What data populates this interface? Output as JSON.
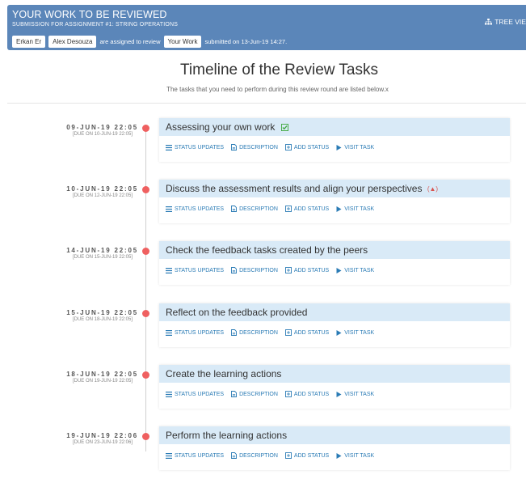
{
  "header": {
    "title": "YOUR WORK TO BE REVIEWED",
    "subtitle": "SUBMISSION FOR ASSIGNMENT #1: STRING OPERATIONS",
    "reviewer_1": "Erkan Er",
    "reviewer_2": "Alex Desouza",
    "assigned_text": "are assigned to review",
    "your_work": "Your Work",
    "submitted_text": "submitted on 13-Jun-19 14:27.",
    "tree_view": "TREE VIEW"
  },
  "page": {
    "title": "Timeline of the Review Tasks",
    "subtitle": "The tasks that you need to perform during this review round are listed below.x"
  },
  "actions": {
    "status_updates": "STATUS UPDATES",
    "description": "DESCRIPTION",
    "add_status": "ADD STATUS",
    "visit_task": "VISIT TASK"
  },
  "tasks": [
    {
      "date": "09-JUN-19 22:05",
      "due": "[DUE ON 10-JUN-19 22:05]",
      "title": "Assessing your own work",
      "status": "done"
    },
    {
      "date": "10-JUN-19 22:05",
      "due": "[DUE ON 12-JUN-19 22:05]",
      "title": "Discuss the assessment results and align your perspectives",
      "status": "alert"
    },
    {
      "date": "14-JUN-19 22:05",
      "due": "[DUE ON 15-JUN-19 22:05]",
      "title": "Check the feedback tasks created by the peers",
      "status": ""
    },
    {
      "date": "15-JUN-19 22:05",
      "due": "[DUE ON 18-JUN-19 22:05]",
      "title": "Reflect on the feedback provided",
      "status": ""
    },
    {
      "date": "18-JUN-19 22:05",
      "due": "[DUE ON 19-JUN-19 22:05]",
      "title": "Create the learning actions",
      "status": ""
    },
    {
      "date": "19-JUN-19 22:06",
      "due": "[DUE ON 23-JUN-19 22:06]",
      "title": "Perform the learning actions",
      "status": ""
    }
  ],
  "colors": {
    "header_bg": "#5b86b9",
    "card_title_bg": "#d9eaf7",
    "dot": "#ef6060",
    "link": "#2a7bb5",
    "done_icon": "#3ea83e",
    "alert_icon": "#d9534f"
  },
  "icons": {
    "tree_view": "sitemap-icon",
    "status_updates": "list-icon",
    "description": "file-icon",
    "add_status": "plus-square-icon",
    "visit_task": "play-icon",
    "done": "check-square-icon",
    "alert": "warning-icon"
  }
}
